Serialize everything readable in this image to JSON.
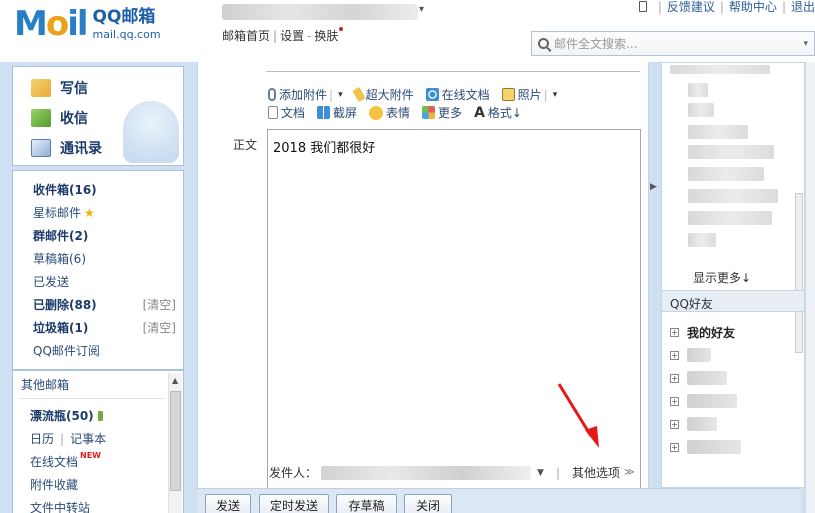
{
  "header": {
    "logo_text": "M",
    "logo_o": "o",
    "logo_il": "il",
    "title": "QQ邮箱",
    "subtitle": "mail.qq.com",
    "links": [
      "邮箱首页",
      "设置",
      "换肤"
    ],
    "top_links": [
      "反馈建议",
      "帮助中心",
      "退出"
    ],
    "search_placeholder": "邮件全文搜索..."
  },
  "sidebar": {
    "actions": [
      {
        "label": "写信",
        "icon": "compose-icon"
      },
      {
        "label": "收信",
        "icon": "inbox-download-icon"
      },
      {
        "label": "通讯录",
        "icon": "contacts-icon"
      }
    ],
    "folders": [
      {
        "label": "收件箱(16)",
        "bold": true
      },
      {
        "label": "星标邮件",
        "bold": false,
        "star": "★"
      },
      {
        "label": "群邮件(2)",
        "bold": true
      },
      {
        "label": "草稿箱(6)",
        "bold": false
      },
      {
        "label": "已发送",
        "bold": false
      },
      {
        "label": "已删除(88)",
        "bold": true,
        "clear": "[清空]"
      },
      {
        "label": "垃圾箱(1)",
        "bold": true,
        "clear": "[清空]"
      },
      {
        "label": "QQ邮件订阅",
        "bold": false
      }
    ],
    "other": [
      {
        "label": "其他邮箱"
      },
      {
        "label": "漂流瓶(50)",
        "bold": true
      },
      {
        "label": "日历",
        "extra": "记事本"
      },
      {
        "label": "在线文档",
        "badge": "NEW"
      },
      {
        "label": "附件收藏"
      },
      {
        "label": "文件中转站"
      }
    ]
  },
  "compose": {
    "toolbar1": [
      {
        "label": "添加附件",
        "icon": "paperclip-icon",
        "caret": "▾"
      },
      {
        "label": "超大附件",
        "icon": "big-attachment-icon"
      },
      {
        "label": "在线文档",
        "icon": "online-doc-icon"
      },
      {
        "label": "照片",
        "icon": "photo-icon",
        "caret": "▾"
      }
    ],
    "toolbar2": [
      {
        "label": "文档",
        "icon": "document-icon"
      },
      {
        "label": "截屏",
        "icon": "screenshot-icon"
      },
      {
        "label": "表情",
        "icon": "emoji-icon"
      },
      {
        "label": "更多",
        "icon": "more-icon"
      },
      {
        "label": "格式↓",
        "icon": "format-icon"
      }
    ],
    "body_label": "正文",
    "body_text": "2018 我们都很好",
    "sender_label": "发件人：",
    "other_options": "其他选项"
  },
  "buttons": [
    "发送",
    "定时发送",
    "存草稿",
    "关闭"
  ],
  "right_panel": {
    "show_more": "显示更多↓",
    "qq_friends": "QQ好友",
    "my_friends": "我的好友"
  },
  "colors": {
    "brand_blue": "#2a7ec6",
    "accent_orange": "#e9a21a",
    "band": "#cfe0f2",
    "arrow_red": "#e51818"
  }
}
